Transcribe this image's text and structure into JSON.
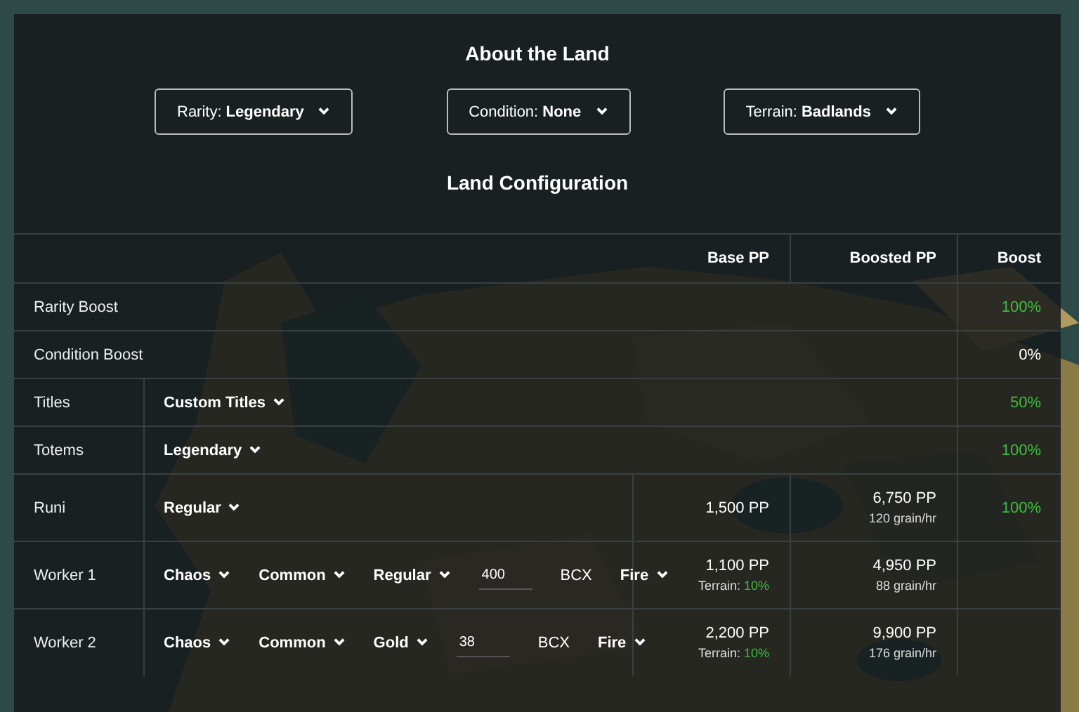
{
  "about": {
    "title": "About the Land",
    "dropdowns": [
      {
        "label": "Rarity:",
        "value": "Legendary"
      },
      {
        "label": "Condition:",
        "value": "None"
      },
      {
        "label": "Terrain:",
        "value": "Badlands"
      }
    ]
  },
  "config": {
    "title": "Land Configuration",
    "columns": [
      "Base PP",
      "Boosted PP",
      "Boost"
    ],
    "rows": [
      {
        "kind": "boost",
        "label": "Rarity Boost",
        "boost": {
          "text": "100%",
          "color": "#3dbd3d"
        }
      },
      {
        "kind": "boost",
        "label": "Condition Boost",
        "boost": {
          "text": "0%",
          "color": "#ffffff"
        }
      },
      {
        "kind": "select",
        "label": "Titles",
        "select": "Custom Titles",
        "boost": {
          "text": "50%",
          "color": "#3dbd3d"
        }
      },
      {
        "kind": "select",
        "label": "Totems",
        "select": "Legendary",
        "boost": {
          "text": "100%",
          "color": "#3dbd3d"
        }
      },
      {
        "kind": "runi",
        "label": "Runi",
        "select": "Regular",
        "base": "1,500 PP",
        "boosted": "6,750 PP",
        "grain": "120 grain/hr",
        "boost": {
          "text": "100%",
          "color": "#3dbd3d"
        }
      },
      {
        "kind": "worker",
        "label": "Worker 1",
        "fields": [
          {
            "kind": "select",
            "value": "Chaos"
          },
          {
            "kind": "select",
            "value": "Common"
          },
          {
            "kind": "select",
            "value": "Regular"
          },
          {
            "kind": "input",
            "value": "400"
          },
          {
            "kind": "text",
            "value": "BCX"
          },
          {
            "kind": "select",
            "value": "Fire"
          }
        ],
        "base": "1,100 PP",
        "terrain": {
          "label": "Terrain:",
          "value": "10%",
          "color": "#3dbd3d"
        },
        "boosted": "4,950 PP",
        "grain": "88 grain/hr"
      },
      {
        "kind": "worker",
        "label": "Worker 2",
        "fields": [
          {
            "kind": "select",
            "value": "Chaos"
          },
          {
            "kind": "select",
            "value": "Common"
          },
          {
            "kind": "select",
            "value": "Gold"
          },
          {
            "kind": "input",
            "value": "38"
          },
          {
            "kind": "text",
            "value": "BCX"
          },
          {
            "kind": "select",
            "value": "Fire"
          }
        ],
        "base": "2,200 PP",
        "terrain": {
          "label": "Terrain:",
          "value": "10%",
          "color": "#3dbd3d"
        },
        "boosted": "9,900 PP",
        "grain": "176 grain/hr"
      }
    ]
  }
}
